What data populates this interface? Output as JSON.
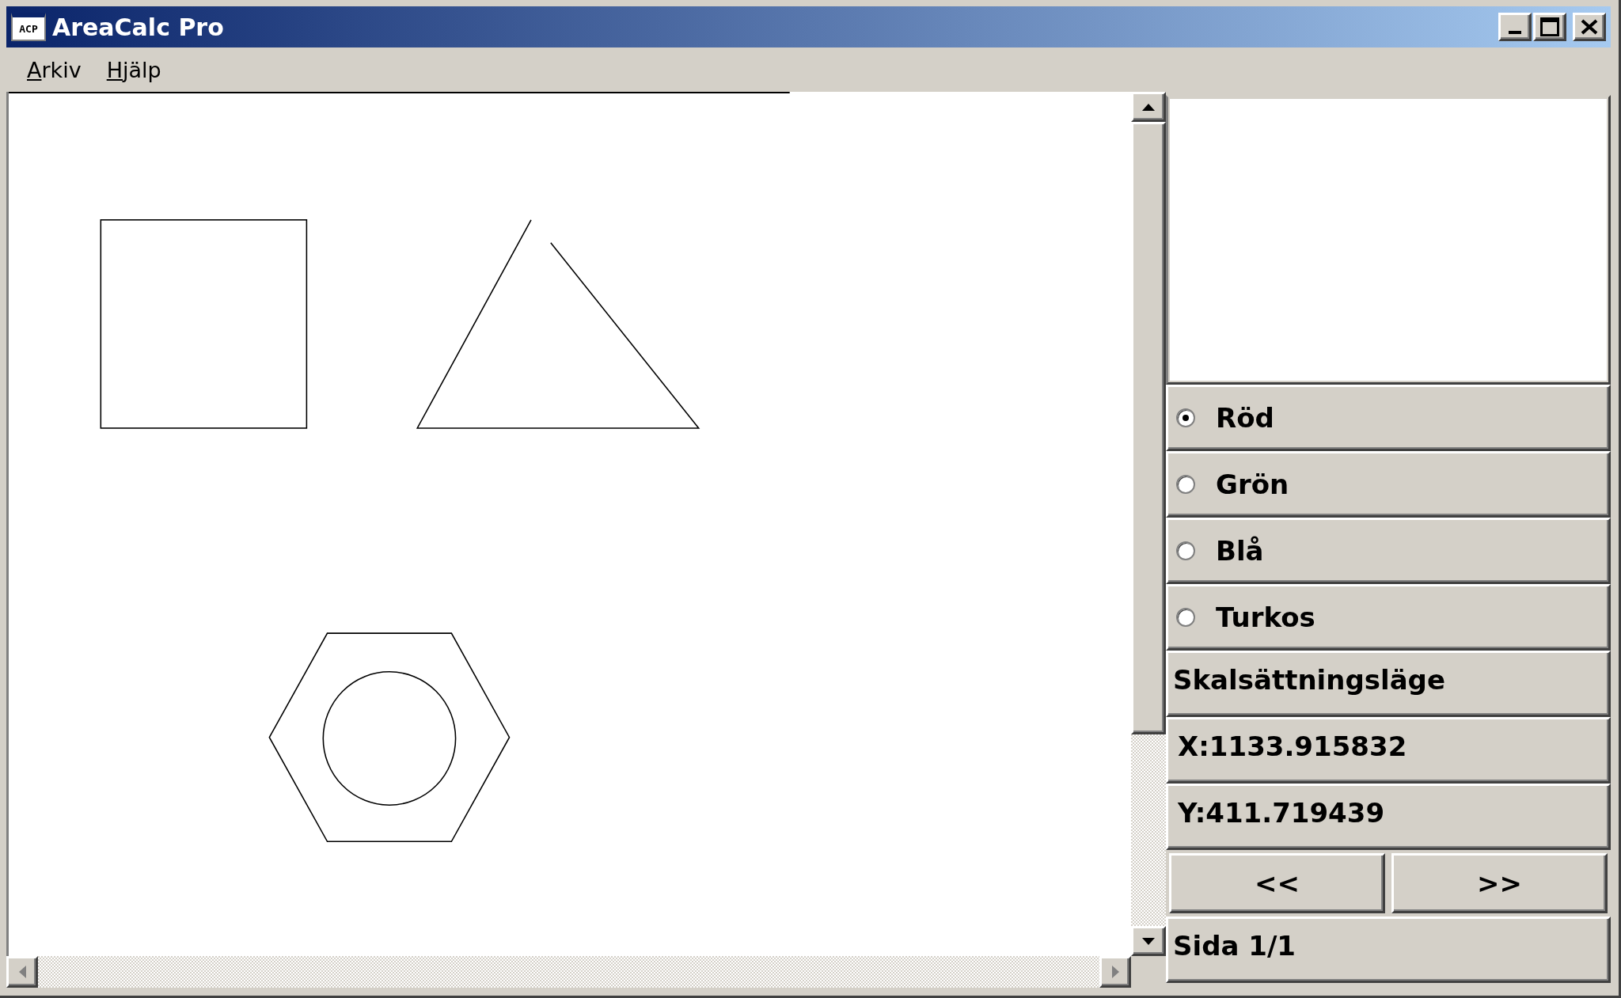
{
  "window": {
    "title": "AreaCalc Pro",
    "icon_text": "ACP"
  },
  "menu": [
    {
      "label": "Arkiv"
    },
    {
      "label": "Hjälp"
    }
  ],
  "canvas": {
    "shapes": [
      {
        "kind": "square"
      },
      {
        "kind": "triangle"
      },
      {
        "kind": "hexagon"
      },
      {
        "kind": "circle"
      }
    ]
  },
  "side_panel": {
    "colors": [
      {
        "label": "Röd",
        "selected": true
      },
      {
        "label": "Grön",
        "selected": false
      },
      {
        "label": "Blå",
        "selected": false
      },
      {
        "label": "Turkos",
        "selected": false
      }
    ],
    "mode": "Skalsättningsläge",
    "x_coord": "X:1133.915832",
    "y_coord": "Y:411.719439",
    "nav_buttons": [
      {
        "label": "<<"
      },
      {
        "label": ">>"
      }
    ],
    "page": "Sida 1/1"
  }
}
